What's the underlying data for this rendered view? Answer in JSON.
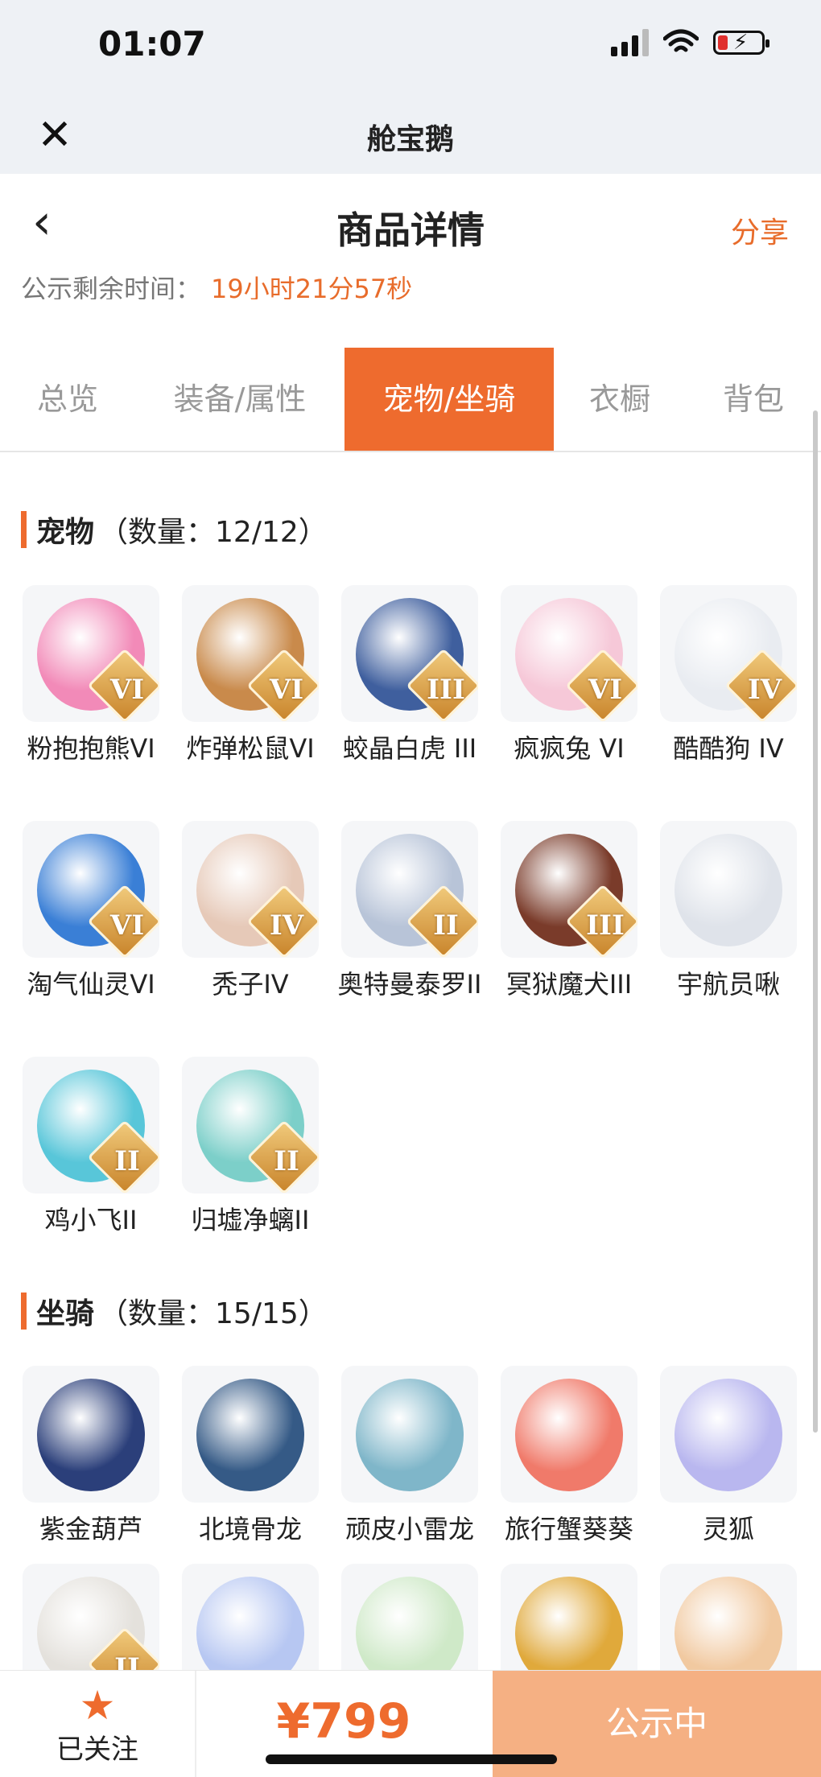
{
  "status_bar": {
    "time": "01:07"
  },
  "app_bar": {
    "title": "舱宝鹅",
    "close_icon": "close-icon"
  },
  "nav": {
    "title": "商品详情",
    "share": "分享",
    "back_icon": "chevron-left-icon"
  },
  "notice": {
    "label": "公示剩余时间：",
    "countdown": "19小时21分57秒"
  },
  "tabs": [
    {
      "label": "总览",
      "active": false
    },
    {
      "label": "装备/属性",
      "active": false
    },
    {
      "label": "宠物/坐骑",
      "active": true
    },
    {
      "label": "衣橱",
      "active": false
    },
    {
      "label": "背包",
      "active": false
    }
  ],
  "pets": {
    "name": "宠物",
    "count": "（数量：12/12）",
    "items": [
      {
        "name": "粉抱抱熊VI",
        "badge": "VI",
        "color": "#f28ab8"
      },
      {
        "name": "炸弹松鼠VI",
        "badge": "VI",
        "color": "#c98a4b"
      },
      {
        "name": "蛟晶白虎 III",
        "badge": "III",
        "color": "#3f5f9e"
      },
      {
        "name": "疯疯兔 VI",
        "badge": "VI",
        "color": "#f6c8d8"
      },
      {
        "name": "酷酷狗 IV",
        "badge": "IV",
        "color": "#e9ecf1"
      },
      {
        "name": "淘气仙灵VI",
        "badge": "VI",
        "color": "#3a7fd6"
      },
      {
        "name": "秃子IV",
        "badge": "IV",
        "color": "#e6c9b8"
      },
      {
        "name": "奥特曼泰罗II",
        "badge": "II",
        "color": "#b8c4d8"
      },
      {
        "name": "冥狱魔犬III",
        "badge": "III",
        "color": "#7a3b2a"
      },
      {
        "name": "宇航员啾",
        "badge": "",
        "color": "#dfe3ea"
      },
      {
        "name": "鸡小飞II",
        "badge": "II",
        "color": "#58c6d9"
      },
      {
        "name": "归墟净螭II",
        "badge": "II",
        "color": "#7ccfc9"
      }
    ]
  },
  "mounts": {
    "name": "坐骑",
    "count": "（数量：15/15）",
    "items": [
      {
        "name": "紫金葫芦",
        "badge": "",
        "color": "#2b3f7a"
      },
      {
        "name": "北境骨龙",
        "badge": "",
        "color": "#355a86"
      },
      {
        "name": "顽皮小雷龙",
        "badge": "",
        "color": "#7fb6c9"
      },
      {
        "name": "旅行蟹葵葵",
        "badge": "",
        "color": "#f07a6a"
      },
      {
        "name": "灵狐",
        "badge": "",
        "color": "#b9b7ef"
      },
      {
        "name": "",
        "badge": "II",
        "color": "#e4e1dc"
      },
      {
        "name": "",
        "badge": "",
        "color": "#b7c7f2"
      },
      {
        "name": "",
        "badge": "",
        "color": "#cfe9c8"
      },
      {
        "name": "",
        "badge": "",
        "color": "#e0a93b"
      },
      {
        "name": "",
        "badge": "",
        "color": "#f1c9a0"
      }
    ]
  },
  "bottom": {
    "follow_label": "已关注",
    "price": "¥799",
    "status": "公示中"
  }
}
